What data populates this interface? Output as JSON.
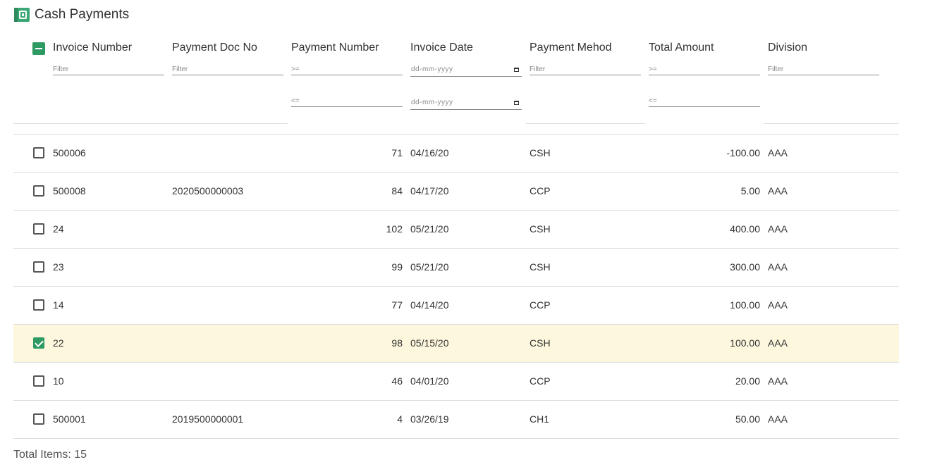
{
  "app": {
    "title": "Cash Payments",
    "icon": "cash-register-icon",
    "accent_color": "#2e9a63",
    "selected_row_color": "#fdf8dd"
  },
  "columns": [
    {
      "key": "invoice_number",
      "label": "Invoice Number"
    },
    {
      "key": "payment_doc_no",
      "label": "Payment Doc No"
    },
    {
      "key": "payment_number",
      "label": "Payment Number"
    },
    {
      "key": "invoice_date",
      "label": "Invoice Date"
    },
    {
      "key": "payment_method",
      "label": "Payment Mehod"
    },
    {
      "key": "total_amount",
      "label": "Total Amount"
    },
    {
      "key": "division",
      "label": "Division"
    }
  ],
  "filters": {
    "invoice_number": {
      "placeholder": "Filter",
      "value": ""
    },
    "payment_doc_no": {
      "placeholder": "Filter",
      "value": ""
    },
    "payment_number_min": {
      "placeholder": ">=",
      "value": ""
    },
    "payment_number_max": {
      "placeholder": "<=",
      "value": ""
    },
    "invoice_date_from": {
      "placeholder": "dd-mm-yyyy",
      "value": ""
    },
    "invoice_date_to": {
      "placeholder": "dd-mm-yyyy",
      "value": ""
    },
    "payment_method": {
      "placeholder": "Filter",
      "value": ""
    },
    "total_amount_min": {
      "placeholder": ">=",
      "value": ""
    },
    "total_amount_max": {
      "placeholder": "<=",
      "value": ""
    },
    "division": {
      "placeholder": "Filter",
      "value": ""
    }
  },
  "header_checkbox_state": "indeterminate",
  "rows": [
    {
      "checked": false,
      "invoice_number": "500006",
      "payment_doc_no": "",
      "payment_number": "71",
      "invoice_date": "04/16/20",
      "payment_method": "CSH",
      "total_amount": "-100.00",
      "division": "AAA"
    },
    {
      "checked": false,
      "invoice_number": "500008",
      "payment_doc_no": "2020500000003",
      "payment_number": "84",
      "invoice_date": "04/17/20",
      "payment_method": "CCP",
      "total_amount": "5.00",
      "division": "AAA"
    },
    {
      "checked": false,
      "invoice_number": "24",
      "payment_doc_no": "",
      "payment_number": "102",
      "invoice_date": "05/21/20",
      "payment_method": "CSH",
      "total_amount": "400.00",
      "division": "AAA"
    },
    {
      "checked": false,
      "invoice_number": "23",
      "payment_doc_no": "",
      "payment_number": "99",
      "invoice_date": "05/21/20",
      "payment_method": "CSH",
      "total_amount": "300.00",
      "division": "AAA"
    },
    {
      "checked": false,
      "invoice_number": "14",
      "payment_doc_no": "",
      "payment_number": "77",
      "invoice_date": "04/14/20",
      "payment_method": "CCP",
      "total_amount": "100.00",
      "division": "AAA"
    },
    {
      "checked": true,
      "invoice_number": "22",
      "payment_doc_no": "",
      "payment_number": "98",
      "invoice_date": "05/15/20",
      "payment_method": "CSH",
      "total_amount": "100.00",
      "division": "AAA"
    },
    {
      "checked": false,
      "invoice_number": "10",
      "payment_doc_no": "",
      "payment_number": "46",
      "invoice_date": "04/01/20",
      "payment_method": "CCP",
      "total_amount": "20.00",
      "division": "AAA"
    },
    {
      "checked": false,
      "invoice_number": "500001",
      "payment_doc_no": "2019500000001",
      "payment_number": "4",
      "invoice_date": "03/26/19",
      "payment_method": "CH1",
      "total_amount": "50.00",
      "division": "AAA"
    }
  ],
  "footer": {
    "total_items_label": "Total Items: 15"
  }
}
